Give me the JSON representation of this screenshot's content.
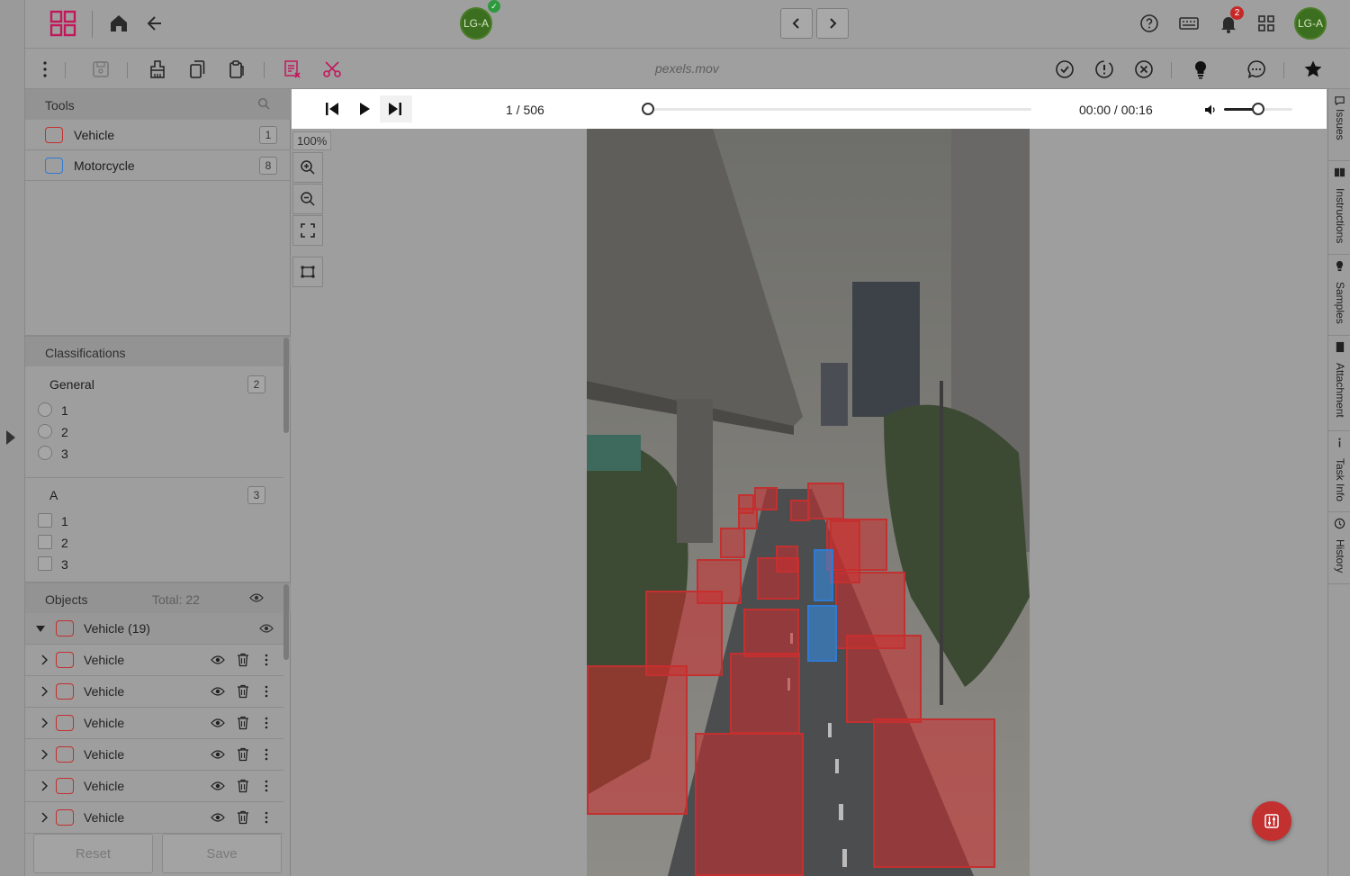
{
  "header": {
    "user_initials": "LG-A",
    "notification_count": "2"
  },
  "toolbar": {
    "filename": "pexels.mov"
  },
  "tools": {
    "title": "Tools",
    "items": [
      {
        "label": "Vehicle",
        "count": "1",
        "color": "#c23030"
      },
      {
        "label": "Motorcycle",
        "count": "8",
        "color": "#2f7bd4"
      }
    ]
  },
  "classifications": {
    "title": "Classifications",
    "groups": [
      {
        "name": "General",
        "count": "2",
        "type": "radio",
        "options": [
          "1",
          "2",
          "3"
        ]
      },
      {
        "name": "A",
        "count": "3",
        "type": "checkbox",
        "options": [
          "1",
          "2",
          "3"
        ]
      }
    ]
  },
  "objects": {
    "title": "Objects",
    "total": "Total: 22",
    "group_label": "Vehicle (19)",
    "rows": [
      "Vehicle",
      "Vehicle",
      "Vehicle",
      "Vehicle",
      "Vehicle",
      "Vehicle"
    ]
  },
  "actions": {
    "reset": "Reset",
    "save": "Save"
  },
  "player": {
    "frame": "1 / 506",
    "time": "00:00 / 00:16",
    "progress": 0.0,
    "volume": 0.5
  },
  "canvas": {
    "zoom": "100%"
  },
  "rightbar": {
    "tabs": [
      "Issues",
      "Instructions",
      "Samples",
      "Attachment",
      "Task Info",
      "History"
    ]
  },
  "colors": {
    "vehicle": "#c23030",
    "motorcycle": "#2f7bd4",
    "avatar": "#3c6e1f"
  }
}
